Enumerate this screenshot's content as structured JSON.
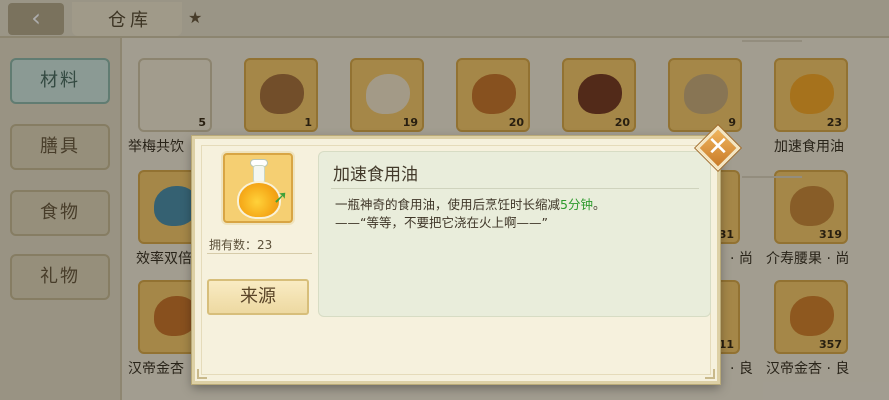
{
  "header": {
    "back_icon": "‹",
    "title": "仓库",
    "star_icon": "★"
  },
  "sidebar": {
    "items": [
      {
        "label": "材料",
        "active": true
      },
      {
        "label": "膳具",
        "active": false
      },
      {
        "label": "食物",
        "active": false
      },
      {
        "label": "礼物",
        "active": false
      }
    ]
  },
  "inventory": {
    "row1_counts": [
      "5",
      "1",
      "19",
      "20",
      "20",
      "9",
      "23"
    ],
    "row2_counts": [
      "31",
      "319"
    ],
    "row3_counts": [
      "11",
      "357"
    ],
    "names": {
      "r1_left": "举梅共饮",
      "r1_right": "加速食用油",
      "r2_left": "效率双倍",
      "r2_mid": "· 尚",
      "r2_right": "介寿腰果 · 尚",
      "r3_left": "汉帝金杏",
      "r3_mid": "· 良",
      "r3_right": "汉帝金杏 · 良"
    }
  },
  "popup": {
    "item_name": "加速食用油",
    "owned_label": "拥有数：23",
    "source_button": "来源",
    "desc_part1": "一瓶神奇的食用油，使用后烹饪时长缩减",
    "desc_highlight": "5分钟",
    "desc_part2": "。",
    "desc_line2": "——“等等，不要把它浇在火上啊——”",
    "close_icon": "✕"
  },
  "colors": {
    "highlight_green": "#2c9a2b",
    "item_slot_gold": "#f3c86b",
    "panel_cream": "#f6f1dd",
    "close_button": "#d9913e"
  }
}
